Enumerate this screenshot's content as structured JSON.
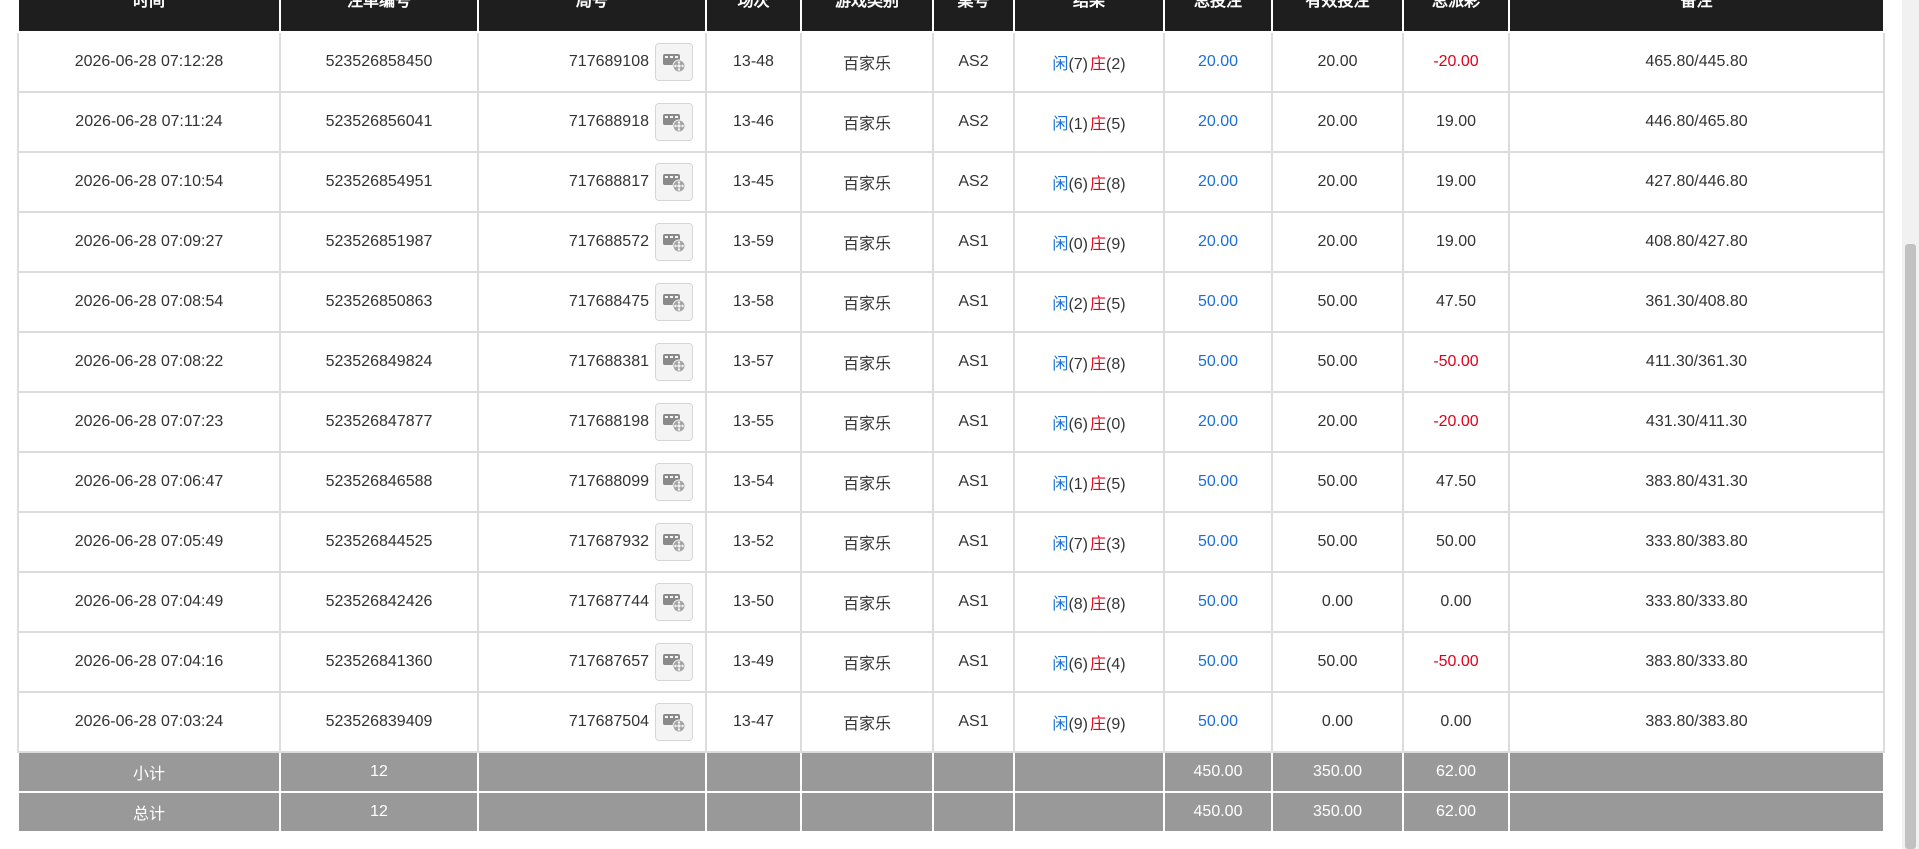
{
  "table": {
    "headers": [
      "时间",
      "注单编号",
      "局号",
      "场次",
      "游戏类别",
      "桌号",
      "结果",
      "总投注",
      "有效投注",
      "总派彩",
      "备注"
    ],
    "result_labels": {
      "player": "闲",
      "banker": "庄"
    },
    "rows": [
      {
        "time": "2026-06-28 07:12:28",
        "bet_id": "523526858450",
        "round": "717689108",
        "shoe": "13-48",
        "game": "百家乐",
        "table": "AS2",
        "player": "(7)",
        "banker": "(2)",
        "total_bet": "20.00",
        "valid_bet": "20.00",
        "payout": "-20.00",
        "payout_color": "red",
        "note": "465.80/445.80"
      },
      {
        "time": "2026-06-28 07:11:24",
        "bet_id": "523526856041",
        "round": "717688918",
        "shoe": "13-46",
        "game": "百家乐",
        "table": "AS2",
        "player": "(1)",
        "banker": "(5)",
        "total_bet": "20.00",
        "valid_bet": "20.00",
        "payout": "19.00",
        "payout_color": "normal",
        "note": "446.80/465.80"
      },
      {
        "time": "2026-06-28 07:10:54",
        "bet_id": "523526854951",
        "round": "717688817",
        "shoe": "13-45",
        "game": "百家乐",
        "table": "AS2",
        "player": "(6)",
        "banker": "(8)",
        "total_bet": "20.00",
        "valid_bet": "20.00",
        "payout": "19.00",
        "payout_color": "normal",
        "note": "427.80/446.80"
      },
      {
        "time": "2026-06-28 07:09:27",
        "bet_id": "523526851987",
        "round": "717688572",
        "shoe": "13-59",
        "game": "百家乐",
        "table": "AS1",
        "player": "(0)",
        "banker": "(9)",
        "total_bet": "20.00",
        "valid_bet": "20.00",
        "payout": "19.00",
        "payout_color": "normal",
        "note": "408.80/427.80"
      },
      {
        "time": "2026-06-28 07:08:54",
        "bet_id": "523526850863",
        "round": "717688475",
        "shoe": "13-58",
        "game": "百家乐",
        "table": "AS1",
        "player": "(2)",
        "banker": "(5)",
        "total_bet": "50.00",
        "valid_bet": "50.00",
        "payout": "47.50",
        "payout_color": "normal",
        "note": "361.30/408.80"
      },
      {
        "time": "2026-06-28 07:08:22",
        "bet_id": "523526849824",
        "round": "717688381",
        "shoe": "13-57",
        "game": "百家乐",
        "table": "AS1",
        "player": "(7)",
        "banker": "(8)",
        "total_bet": "50.00",
        "valid_bet": "50.00",
        "payout": "-50.00",
        "payout_color": "red",
        "note": "411.30/361.30"
      },
      {
        "time": "2026-06-28 07:07:23",
        "bet_id": "523526847877",
        "round": "717688198",
        "shoe": "13-55",
        "game": "百家乐",
        "table": "AS1",
        "player": "(6)",
        "banker": "(0)",
        "total_bet": "20.00",
        "valid_bet": "20.00",
        "payout": "-20.00",
        "payout_color": "red",
        "note": "431.30/411.30"
      },
      {
        "time": "2026-06-28 07:06:47",
        "bet_id": "523526846588",
        "round": "717688099",
        "shoe": "13-54",
        "game": "百家乐",
        "table": "AS1",
        "player": "(1)",
        "banker": "(5)",
        "total_bet": "50.00",
        "valid_bet": "50.00",
        "payout": "47.50",
        "payout_color": "normal",
        "note": "383.80/431.30"
      },
      {
        "time": "2026-06-28 07:05:49",
        "bet_id": "523526844525",
        "round": "717687932",
        "shoe": "13-52",
        "game": "百家乐",
        "table": "AS1",
        "player": "(7)",
        "banker": "(3)",
        "total_bet": "50.00",
        "valid_bet": "50.00",
        "payout": "50.00",
        "payout_color": "normal",
        "note": "333.80/383.80"
      },
      {
        "time": "2026-06-28 07:04:49",
        "bet_id": "523526842426",
        "round": "717687744",
        "shoe": "13-50",
        "game": "百家乐",
        "table": "AS1",
        "player": "(8)",
        "banker": "(8)",
        "total_bet": "50.00",
        "valid_bet": "0.00",
        "payout": "0.00",
        "payout_color": "normal",
        "note": "333.80/333.80"
      },
      {
        "time": "2026-06-28 07:04:16",
        "bet_id": "523526841360",
        "round": "717687657",
        "shoe": "13-49",
        "game": "百家乐",
        "table": "AS1",
        "player": "(6)",
        "banker": "(4)",
        "total_bet": "50.00",
        "valid_bet": "50.00",
        "payout": "-50.00",
        "payout_color": "red",
        "note": "383.80/333.80"
      },
      {
        "time": "2026-06-28 07:03:24",
        "bet_id": "523526839409",
        "round": "717687504",
        "shoe": "13-47",
        "game": "百家乐",
        "table": "AS1",
        "player": "(9)",
        "banker": "(9)",
        "total_bet": "50.00",
        "valid_bet": "0.00",
        "payout": "0.00",
        "payout_color": "normal",
        "note": "383.80/383.80"
      }
    ],
    "subtotal": {
      "label": "小计",
      "count": "12",
      "total_bet": "450.00",
      "valid_bet": "350.00",
      "payout": "62.00"
    },
    "grand_total": {
      "label": "总计",
      "count": "12",
      "total_bet": "450.00",
      "valid_bet": "350.00",
      "payout": "62.00"
    }
  },
  "icons": {
    "round_detail": "film-reel-icon"
  },
  "colors": {
    "header_bg": "#1e1e1e",
    "footer_bg": "#999999",
    "blue": "#1a6fd8",
    "red": "#e0001b"
  }
}
